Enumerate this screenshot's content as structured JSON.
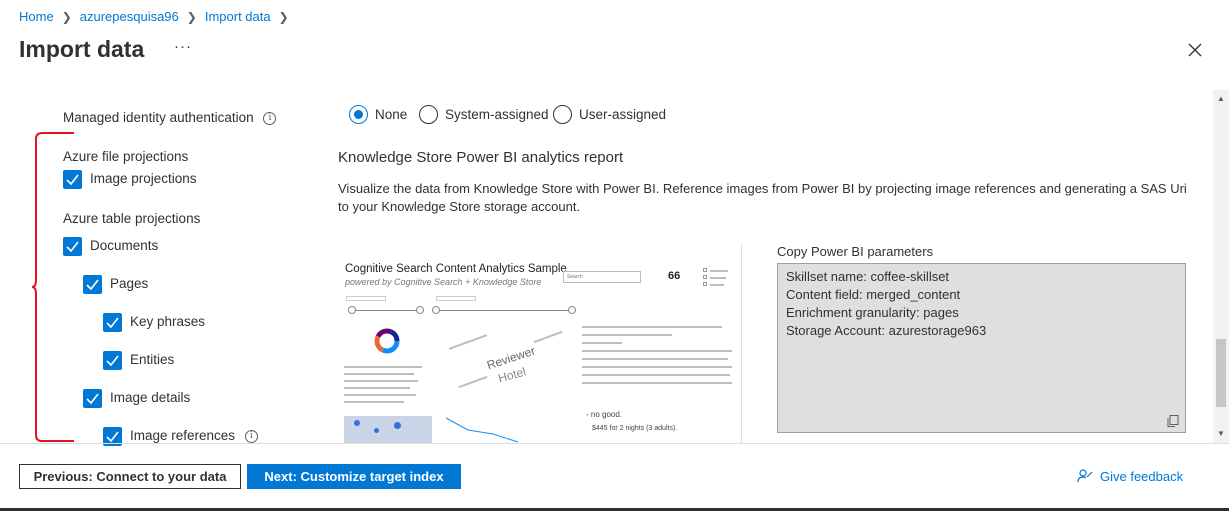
{
  "breadcrumb": [
    "Home",
    "azurepesquisa96",
    "Import data"
  ],
  "page_title": "Import data",
  "more_label": "···",
  "managed_identity": {
    "label": "Managed identity authentication",
    "options": [
      "None",
      "System-assigned",
      "User-assigned"
    ],
    "selected": "None"
  },
  "projections": {
    "file_heading": "Azure file projections",
    "file_items": [
      {
        "label": "Image projections",
        "checked": true
      }
    ],
    "table_heading": "Azure table projections",
    "table_items": [
      {
        "label": "Documents",
        "checked": true
      },
      {
        "label": "Pages",
        "checked": true
      },
      {
        "label": "Key phrases",
        "checked": true
      },
      {
        "label": "Entities",
        "checked": true
      },
      {
        "label": "Image details",
        "checked": true
      },
      {
        "label": "Image references",
        "checked": true
      }
    ]
  },
  "powerbi": {
    "heading": "Knowledge Store Power BI analytics report",
    "description": "Visualize the data from Knowledge Store with Power BI. Reference images from Power BI by projecting image references and generating a SAS Uri to your Knowledge Store storage account.",
    "report_title": "Cognitive Search Content Analytics Sample",
    "report_subtitle": "powered by Cognitive Search + Knowledge Store",
    "report_kpi": "66",
    "report_search_placeholder": "Search",
    "report_tag_reviewer": "Reviewer",
    "report_tag_hotel": "Hotel",
    "report_quote": "- no good.",
    "report_price": "$445 for 2 nights (3 adults).",
    "params_label": "Copy Power BI parameters",
    "params": [
      "Skillset name: coffee-skillset",
      "Content field: merged_content",
      "Enrichment granularity: pages",
      "Storage Account: azurestorage963"
    ]
  },
  "footer": {
    "prev_label": "Previous: Connect to your data",
    "next_label": "Next: Customize target index",
    "feedback_label": "Give feedback"
  },
  "colors": {
    "accent": "#0078d4",
    "annotation": "#e81123"
  }
}
